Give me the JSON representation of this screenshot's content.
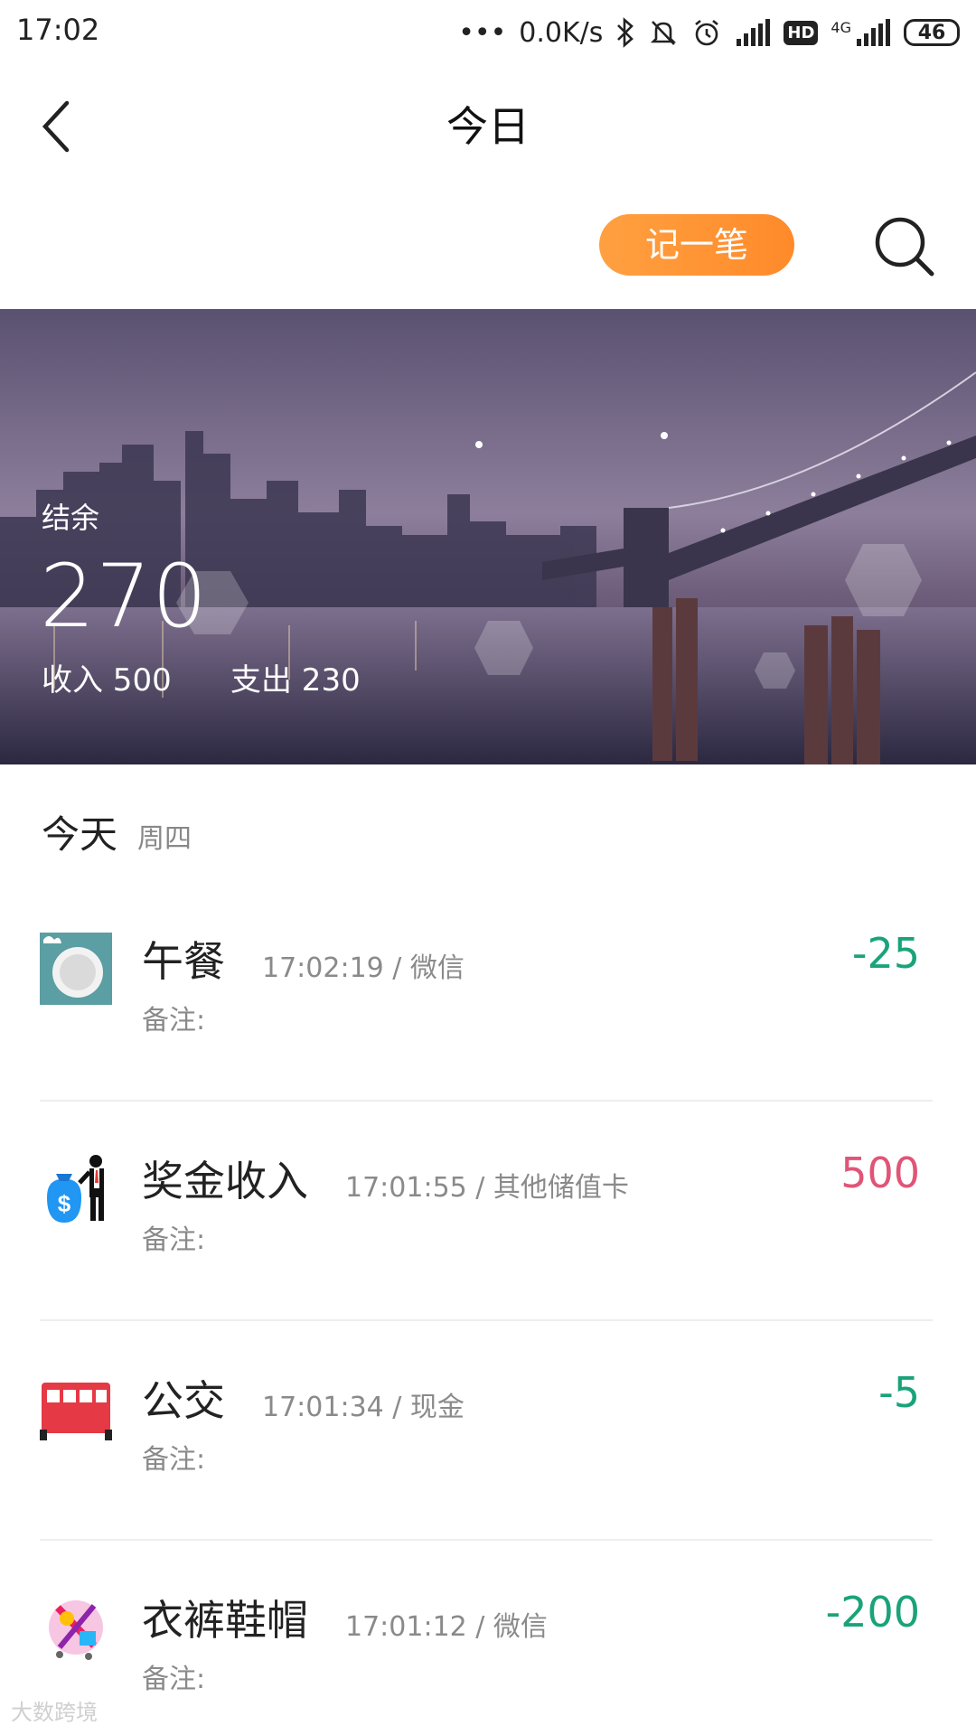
{
  "status_bar": {
    "time": "17:02",
    "network_speed": "0.0K/s",
    "network_type": "4G",
    "hd_badge": "HD",
    "battery": "46"
  },
  "nav": {
    "title": "今日"
  },
  "toolbar": {
    "record_label": "记一笔"
  },
  "summary": {
    "balance_label": "结余",
    "balance_value": "270",
    "income_text": "收入 500",
    "expense_text": "支出 230"
  },
  "day": {
    "label": "今天",
    "weekday": "周四"
  },
  "entries": [
    {
      "name": "午餐",
      "meta": "17:02:19 / 微信",
      "note": "备注:",
      "amount": "-25",
      "icon": "meal-plate-icon"
    },
    {
      "name": "奖金收入",
      "meta": "17:01:55 / 其他储值卡",
      "note": "备注:",
      "amount": "500",
      "icon": "money-bag-icon"
    },
    {
      "name": "公交",
      "meta": "17:01:34 / 现金",
      "note": "备注:",
      "amount": "-5",
      "icon": "bus-icon"
    },
    {
      "name": "衣裤鞋帽",
      "meta": "17:01:12 / 微信",
      "note": "备注:",
      "amount": "-200",
      "icon": "shopping-icon"
    }
  ],
  "colors": {
    "accent": "#ff8a2a",
    "expense": "#1aa37a",
    "income": "#e05577"
  },
  "watermark": "大数跨境"
}
